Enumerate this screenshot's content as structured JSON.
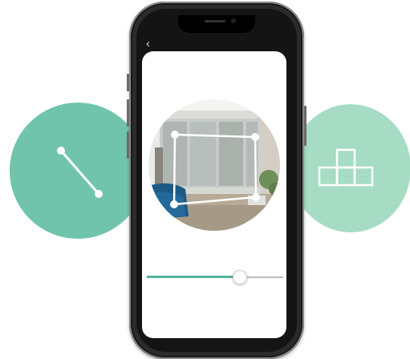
{
  "icons": {
    "left_circle": "measure-line-icon",
    "right_circle": "blocks-icon",
    "back": "chevron-left-icon"
  },
  "nav": {
    "back_label": "‹"
  },
  "slider": {
    "value": 0.68
  },
  "colors": {
    "left_circle": "#70c4ac",
    "right_circle": "#a6dcc4",
    "accent": "#53b39b",
    "phone_body": "#2b2b2b"
  }
}
